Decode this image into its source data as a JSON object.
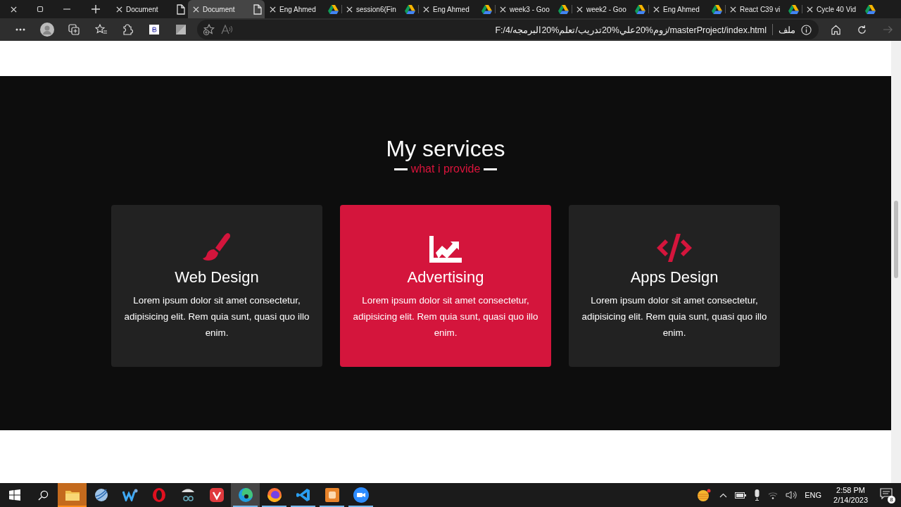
{
  "tabs": [
    {
      "label": "Document",
      "kind": "file",
      "selected": false
    },
    {
      "label": "Document",
      "kind": "file",
      "selected": true
    },
    {
      "label": "Eng Ahmed",
      "kind": "drive",
      "selected": false
    },
    {
      "label": "session6(Fin",
      "kind": "drive",
      "selected": false
    },
    {
      "label": "Eng Ahmed",
      "kind": "drive",
      "selected": false
    },
    {
      "label": "week3 - Goo",
      "kind": "drive",
      "selected": false
    },
    {
      "label": "week2 - Goo",
      "kind": "drive",
      "selected": false
    },
    {
      "label": "Eng Ahmed",
      "kind": "drive",
      "selected": false
    },
    {
      "label": "React C39 vi",
      "kind": "drive",
      "selected": false
    },
    {
      "label": "Cycle 40 Vid",
      "kind": "drive",
      "selected": false
    }
  ],
  "address_bar": {
    "url": "F:/4/زوم%20علي%20تدريب/تعلم%20البرمجه/masterProject/index.html",
    "site_label": "ملف"
  },
  "services": {
    "title": "My services",
    "subtitle": "what i provide",
    "cards": [
      {
        "title": "Web Design",
        "text": "Lorem ipsum dolor sit amet consectetur, adipisicing elit. Rem quia sunt, quasi quo illo enim.",
        "highlighted": false
      },
      {
        "title": "Advertising",
        "text": "Lorem ipsum dolor sit amet consectetur, adipisicing elit. Rem quia sunt, quasi quo illo enim.",
        "highlighted": true
      },
      {
        "title": "Apps Design",
        "text": "Lorem ipsum dolor sit amet consectetur, adipisicing elit. Rem quia sunt, quasi quo illo enim.",
        "highlighted": false
      }
    ]
  },
  "taskbar": {
    "apps": [
      {
        "kind": "explorer",
        "running": false,
        "active": false,
        "attention": true
      },
      {
        "kind": "globe",
        "running": false,
        "active": false,
        "attention": false
      },
      {
        "kind": "wave",
        "running": false,
        "active": false,
        "attention": false
      },
      {
        "kind": "opera",
        "running": false,
        "active": false,
        "attention": false
      },
      {
        "kind": "snip",
        "running": false,
        "active": false,
        "attention": false
      },
      {
        "kind": "vivaldi",
        "running": false,
        "active": false,
        "attention": false
      },
      {
        "kind": "edge",
        "running": true,
        "active": true,
        "attention": false
      },
      {
        "kind": "firefox",
        "running": true,
        "active": false,
        "attention": false
      },
      {
        "kind": "vscode",
        "running": true,
        "active": false,
        "attention": false
      },
      {
        "kind": "square",
        "running": true,
        "active": false,
        "attention": false
      },
      {
        "kind": "zoom",
        "running": true,
        "active": false,
        "attention": false
      }
    ],
    "language": "ENG",
    "time": "2:58 PM",
    "date": "2/14/2023",
    "notifications": "8"
  }
}
